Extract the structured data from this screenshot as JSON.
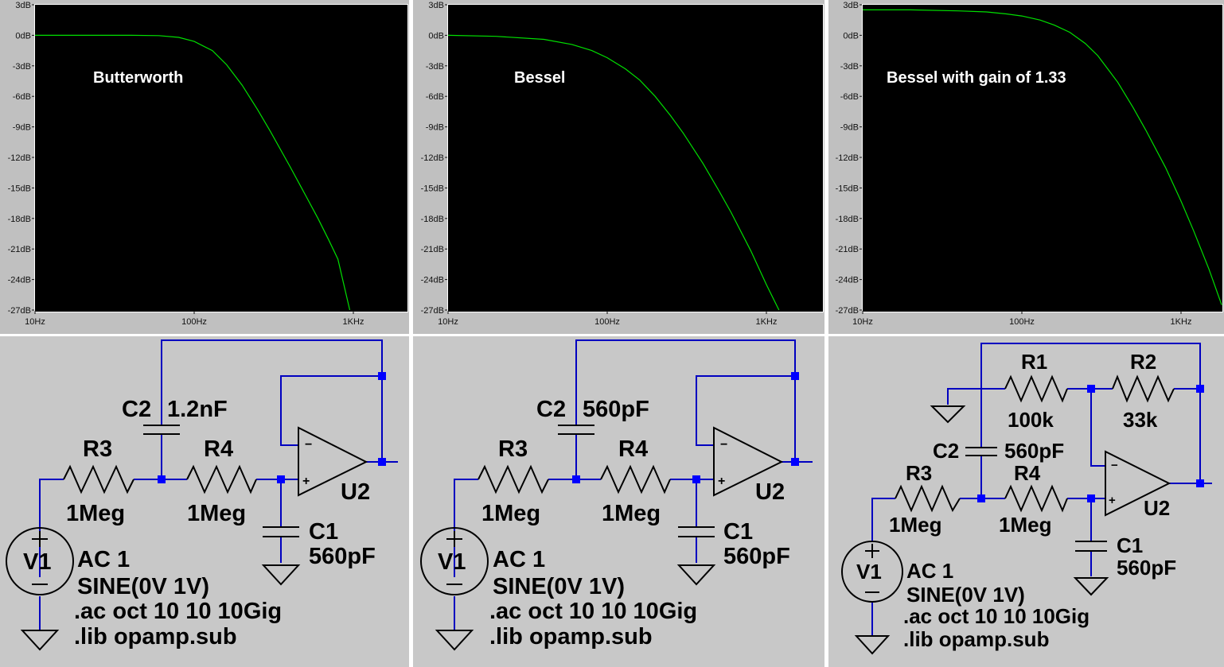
{
  "colors": {
    "plot_bg": "#000000",
    "trace": "#00e000",
    "wire": "#0000c0",
    "junction": "#0000ff",
    "schematic_bg": "#c8c8c8",
    "axis_text": "#111111"
  },
  "axes": {
    "y_ticks": [
      "3dB",
      "0dB",
      "-3dB",
      "-6dB",
      "-9dB",
      "-12dB",
      "-15dB",
      "-18dB",
      "-21dB",
      "-24dB",
      "-27dB"
    ],
    "x_ticks": [
      "10Hz",
      "100Hz",
      "1KHz"
    ]
  },
  "chart_data": [
    {
      "type": "line",
      "title": "",
      "annotation": "Butterworth",
      "xscale": "log",
      "xlim": [
        10,
        2000
      ],
      "ylim": [
        -27,
        3
      ],
      "series": [
        {
          "x": [
            10,
            20,
            40,
            60,
            80,
            100,
            130,
            160,
            200,
            250,
            300,
            400,
            500,
            600,
            700,
            800,
            950
          ],
          "y": [
            0,
            0,
            0,
            -0.03,
            -0.2,
            -0.6,
            -1.5,
            -2.9,
            -4.9,
            -7.3,
            -9.4,
            -12.9,
            -15.7,
            -18.0,
            -20.1,
            -22.0,
            -27
          ]
        }
      ]
    },
    {
      "type": "line",
      "title": "",
      "annotation": "Bessel",
      "xscale": "log",
      "xlim": [
        10,
        2000
      ],
      "ylim": [
        -27,
        3
      ],
      "series": [
        {
          "x": [
            10,
            20,
            40,
            60,
            80,
            100,
            130,
            160,
            200,
            250,
            300,
            400,
            500,
            600,
            800,
            1000,
            1200
          ],
          "y": [
            0,
            -0.1,
            -0.4,
            -0.9,
            -1.5,
            -2.2,
            -3.3,
            -4.4,
            -6.0,
            -7.9,
            -9.6,
            -12.6,
            -15.2,
            -17.4,
            -21.2,
            -24.5,
            -27
          ]
        }
      ]
    },
    {
      "type": "line",
      "title": "",
      "annotation": "Bessel with gain of 1.33",
      "xscale": "log",
      "xlim": [
        10,
        2000
      ],
      "ylim": [
        -27,
        3
      ],
      "series": [
        {
          "x": [
            10,
            20,
            40,
            60,
            80,
            100,
            130,
            160,
            200,
            250,
            300,
            400,
            500,
            600,
            800,
            1000,
            1200,
            1500,
            1800
          ],
          "y": [
            2.5,
            2.5,
            2.4,
            2.3,
            2.1,
            1.9,
            1.5,
            1.0,
            0.3,
            -0.8,
            -2.0,
            -4.6,
            -7.1,
            -9.3,
            -13.0,
            -16.3,
            -19.2,
            -23.0,
            -26.5
          ]
        }
      ]
    }
  ],
  "schematics": [
    {
      "c2_name": "C2",
      "c2_value": "1.2nF",
      "r3_name": "R3",
      "r3_value": "1Meg",
      "r4_name": "R4",
      "r4_value": "1Meg",
      "c1_name": "C1",
      "c1_value": "560pF",
      "u_name": "U2",
      "v_name": "V1",
      "plus": "+",
      "minus": "−",
      "directives": [
        "AC 1",
        "SINE(0V 1V)",
        ".ac oct 10 10 10Gig",
        ".lib opamp.sub"
      ]
    },
    {
      "c2_name": "C2",
      "c2_value": "560pF",
      "r3_name": "R3",
      "r3_value": "1Meg",
      "r4_name": "R4",
      "r4_value": "1Meg",
      "c1_name": "C1",
      "c1_value": "560pF",
      "u_name": "U2",
      "v_name": "V1",
      "plus": "+",
      "minus": "−",
      "directives": [
        "AC 1",
        "SINE(0V 1V)",
        ".ac oct 10 10 10Gig",
        ".lib opamp.sub"
      ]
    },
    {
      "r1_name": "R1",
      "r1_value": "100k",
      "r2_name": "R2",
      "r2_value": "33k",
      "c2_name": "C2",
      "c2_value": "560pF",
      "r3_name": "R3",
      "r3_value": "1Meg",
      "r4_name": "R4",
      "r4_value": "1Meg",
      "c1_name": "C1",
      "c1_value": "560pF",
      "u_name": "U2",
      "v_name": "V1",
      "plus": "+",
      "minus": "−",
      "directives": [
        "AC 1",
        "SINE(0V 1V)",
        ".ac oct 10 10 10Gig",
        ".lib opamp.sub"
      ]
    }
  ]
}
